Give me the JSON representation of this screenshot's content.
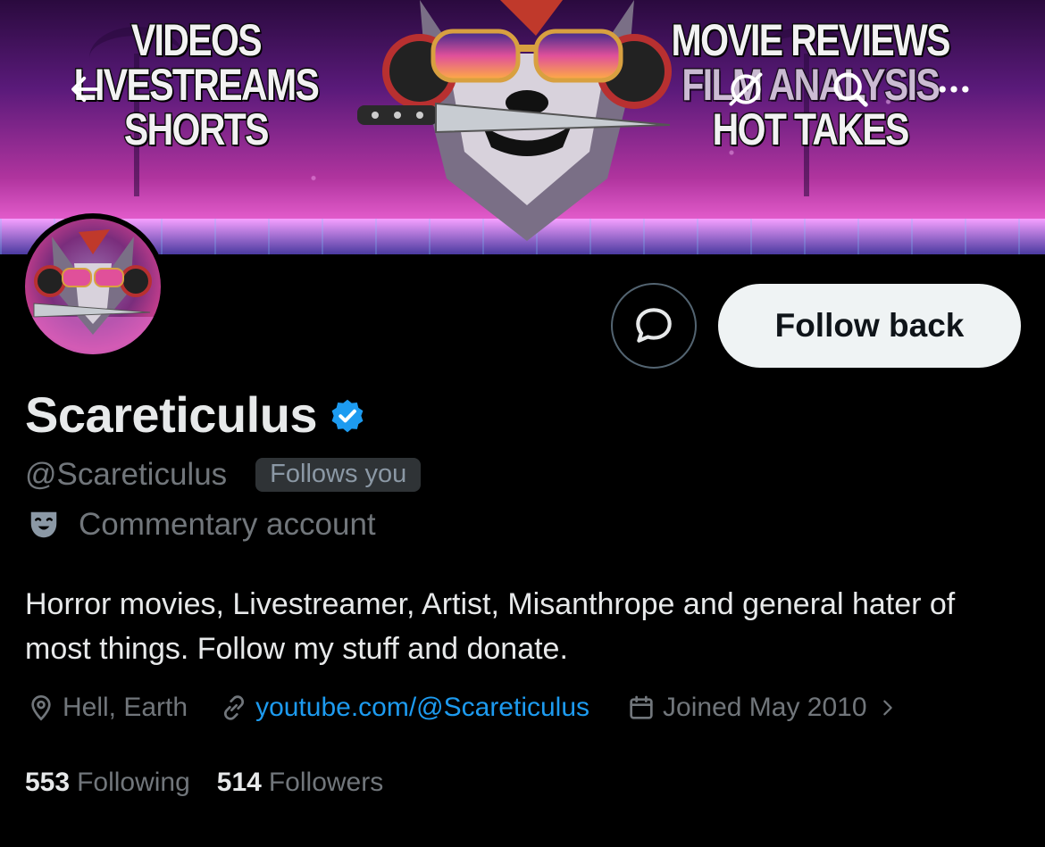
{
  "banner": {
    "left_lines": [
      "VIDEOS",
      "LIVESTREAMS",
      "SHORTS"
    ],
    "right_lines": [
      "MOVIE REVIEWS",
      "FILM ANALYSIS",
      "HOT TAKES"
    ]
  },
  "nav": {
    "back_icon": "arrow-left-icon",
    "grok_icon": "grok-icon",
    "search_icon": "search-icon",
    "more_icon": "more-horizontal-icon"
  },
  "profile": {
    "display_name": "Scareticulus",
    "handle": "@Scareticulus",
    "follows_you": "Follows you",
    "category": "Commentary account",
    "bio": "Horror movies, Livestreamer, Artist, Misanthrope and general hater of most things. Follow my stuff and donate.",
    "location": "Hell, Earth",
    "website": "youtube.com/@Scareticulus",
    "joined": "Joined May 2010",
    "following_count": "553",
    "following_label": "Following",
    "followers_count": "514",
    "followers_label": "Followers"
  },
  "actions": {
    "message_icon": "message-bubble-icon",
    "follow_label": "Follow back"
  },
  "colors": {
    "background": "#000000",
    "text_primary": "#e7e9ea",
    "text_secondary": "#71767b",
    "link": "#1d9bf0",
    "verified": "#1d9bf0",
    "follow_button_bg": "#eff3f4"
  }
}
